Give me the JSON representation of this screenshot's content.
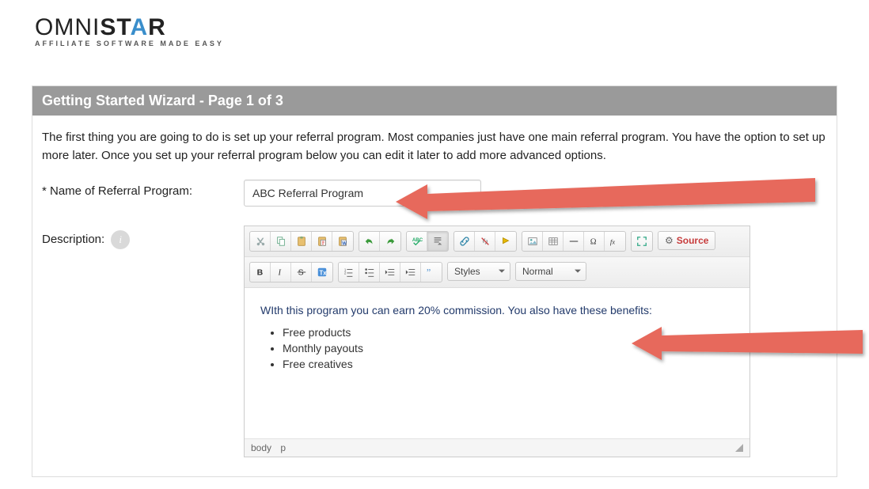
{
  "logo": {
    "brand_left": "OMNI",
    "brand_right": "ST",
    "brand_accent": "A",
    "brand_right2": "R",
    "tagline": "AFFILIATE SOFTWARE MADE EASY"
  },
  "wizard": {
    "heading": "Getting Started Wizard - Page 1 of 3",
    "intro": "The first thing you are going to do is set up your referral program. Most companies just have one main referral program. You have the option to set up more later. Once you set up your referral program below you can edit it later to add more advanced options."
  },
  "form": {
    "name_label": "* Name of Referral Program:",
    "name_value": "ABC Referral Program",
    "description_label": "Description:"
  },
  "editor": {
    "toolbar": {
      "styles_label": "Styles",
      "format_label": "Normal",
      "source_label": "Source"
    },
    "content": {
      "paragraph": "WIth this program you can earn 20% commission. You also have these benefits:",
      "bullets": [
        "Free products",
        "Monthly payouts",
        "Free creatives"
      ]
    },
    "path": {
      "crumb1": "body",
      "crumb2": "p"
    }
  },
  "icons": {
    "cut": "cut-icon",
    "copy": "copy-icon",
    "paste": "paste-icon",
    "paste_text": "paste-text-icon",
    "paste_word": "paste-word-icon",
    "undo": "undo-icon",
    "redo": "redo-icon",
    "spellcheck": "spellcheck-icon",
    "showblocks": "showblocks-icon",
    "link": "link-icon",
    "unlink": "unlink-icon",
    "anchor": "anchor-icon",
    "image": "image-icon",
    "table": "table-icon",
    "hr": "horizontal-rule-icon",
    "specialchar": "specialchar-icon",
    "fx": "function-icon",
    "maximize": "maximize-icon",
    "bold": "bold-icon",
    "italic": "italic-icon",
    "strike": "strike-icon",
    "removeformat": "remove-format-icon",
    "ol": "ordered-list-icon",
    "ul": "unordered-list-icon",
    "outdent": "outdent-icon",
    "indent": "indent-icon",
    "blockquote": "blockquote-icon"
  }
}
